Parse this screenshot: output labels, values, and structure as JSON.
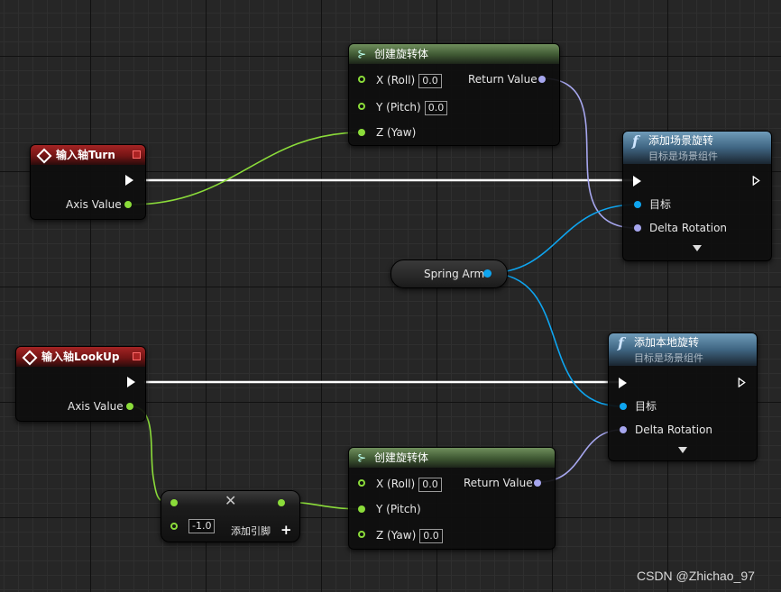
{
  "nodes": {
    "make_rot_top": {
      "title": "创建旋转体",
      "x_label": "X (Roll)",
      "x_value": "0.0",
      "y_label": "Y (Pitch)",
      "y_value": "0.0",
      "z_label": "Z (Yaw)",
      "return_label": "Return Value"
    },
    "input_turn": {
      "title": "输入轴Turn",
      "axis_label": "Axis Value"
    },
    "add_world_rot": {
      "title": "添加场景旋转",
      "subtitle": "目标是场景组件",
      "target_label": "目标",
      "delta_label": "Delta Rotation"
    },
    "spring_arm": {
      "label": "Spring Arm"
    },
    "input_lookup": {
      "title": "输入轴LookUp",
      "axis_label": "Axis Value"
    },
    "add_local_rot": {
      "title": "添加本地旋转",
      "subtitle": "目标是场景组件",
      "target_label": "目标",
      "delta_label": "Delta Rotation"
    },
    "make_rot_bottom": {
      "title": "创建旋转体",
      "x_label": "X (Roll)",
      "x_value": "0.0",
      "y_label": "Y (Pitch)",
      "z_label": "Z (Yaw)",
      "z_value": "0.0",
      "return_label": "Return Value"
    },
    "multiply": {
      "b_value": "-1.0",
      "op_symbol": "✕",
      "add_pin_label": "添加引脚",
      "add_pin_symbol": "+"
    }
  },
  "watermark": "CSDN @Zhichao_97",
  "colors": {
    "float_wire": "#8bdc3a",
    "rotator_wire": "#a6a6ee",
    "object_wire": "#0ea5f0",
    "exec_wire": "#ffffff"
  }
}
